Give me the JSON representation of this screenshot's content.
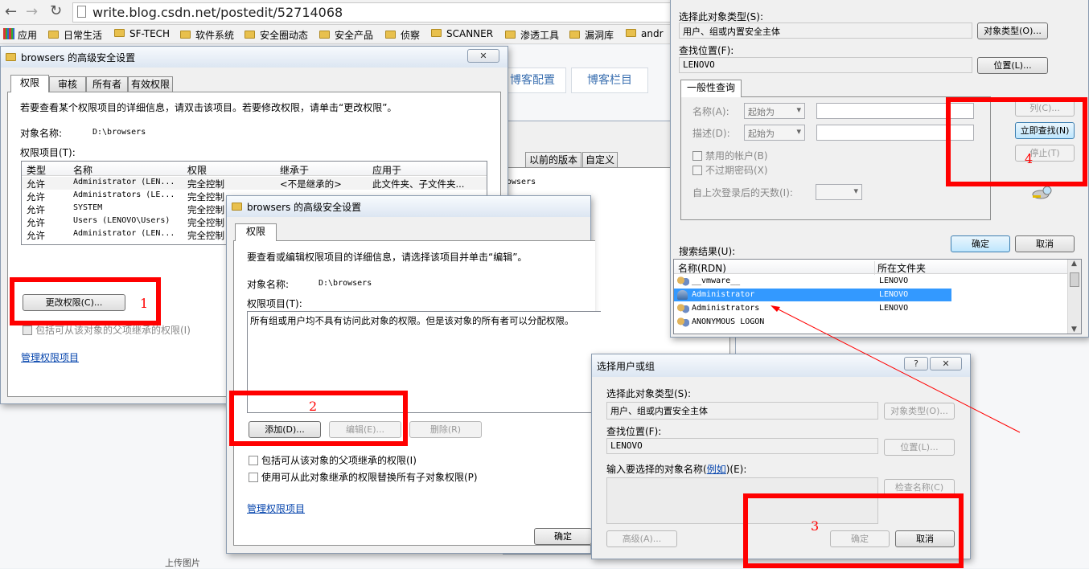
{
  "browser": {
    "url": "write.blog.csdn.net/postedit/52714068",
    "bookmarks": [
      "应用",
      "日常生活",
      "SF-TECH",
      "软件系统",
      "安全圈动态",
      "安全产品",
      "侦察",
      "SCANNER",
      "渗透工具",
      "漏洞库",
      "andr"
    ]
  },
  "bg": {
    "tabs": [
      "博客配置",
      "博客栏目"
    ],
    "tabs2": [
      "以前的版本",
      "自定义"
    ],
    "snip": "owsers",
    "bottom": "上传图片"
  },
  "dlg1": {
    "title": "browsers 的高级安全设置",
    "close": "✕",
    "tabs": [
      "权限",
      "审核",
      "所有者",
      "有效权限"
    ],
    "info": "若要查看某个权限项目的详细信息，请双击该项目。若要修改权限，请单击“更改权限”。",
    "obj_label": "对象名称:",
    "obj_value": "D:\\browsers",
    "perm_label": "权限项目(T):",
    "headers": [
      "类型",
      "名称",
      "权限",
      "继承于",
      "应用于"
    ],
    "rows": [
      [
        "允许",
        "Administrator (LEN...",
        "完全控制",
        "<不是继承的>",
        "此文件夹、子文件夹..."
      ],
      [
        "允许",
        "Administrators (LE...",
        "完全控制",
        "",
        ""
      ],
      [
        "允许",
        "SYSTEM",
        "完全控制",
        "",
        ""
      ],
      [
        "允许",
        "Users (LENOVO\\Users)",
        "完全控制",
        "",
        ""
      ],
      [
        "允许",
        "Administrator (LEN...",
        "完全控制",
        "",
        ""
      ]
    ],
    "change_btn": "更改权限(C)...",
    "include_chk": "包括可从该对象的父项继承的权限(I)",
    "manage_link": "管理权限项目"
  },
  "dlg2": {
    "title": "browsers 的高级安全设置",
    "tab": "权限",
    "info": "要查看或编辑权限项目的详细信息，请选择该项目并单击“编辑”。",
    "obj_label": "对象名称:",
    "obj_value": "D:\\browsers",
    "perm_label": "权限项目(T):",
    "empty_msg": "所有组或用户均不具有访问此对象的权限。但是该对象的所有者可以分配权限。",
    "add_btn": "添加(D)...",
    "edit_btn": "编辑(E)...",
    "del_btn": "删除(R)",
    "chk1": "包括可从该对象的父项继承的权限(I)",
    "chk2": "使用可从此对象继承的权限替换所有子对象权限(P)",
    "manage_link": "管理权限项目",
    "ok_btn": "确定"
  },
  "dlg3": {
    "title": "选择用户或组",
    "help": "?",
    "close": "✕",
    "type_label": "选择此对象类型(S):",
    "type_value": "用户、组或内置安全主体",
    "type_btn": "对象类型(O)...",
    "loc_label": "查找位置(F):",
    "loc_value": "LENOVO",
    "loc_btn": "位置(L)...",
    "name_label_a": "输入要选择的对象名称(",
    "name_link": "例如",
    "name_label_b": ")(E):",
    "check_btn": "检查名称(C)",
    "adv_btn": "高级(A)...",
    "ok_btn": "确定",
    "cancel_btn": "取消"
  },
  "dlg4": {
    "type_label": "选择此对象类型(S):",
    "type_value": "用户、组或内置安全主体",
    "type_btn": "对象类型(O)...",
    "loc_label": "查找位置(F):",
    "loc_value": "LENOVO",
    "loc_btn": "位置(L)...",
    "query_tab": "一般性查询",
    "name_label": "名称(A):",
    "desc_label": "描述(D):",
    "starts_with": "起始为",
    "disabled_chk": "禁用的帐户(B)",
    "noexpire_chk": "不过期密码(X)",
    "days_label": "自上次登录后的天数(I):",
    "cols_btn": "列(C)...",
    "find_btn": "立即查找(N)",
    "stop_btn": "停止(T)",
    "ok_btn": "确定",
    "cancel_btn": "取消",
    "results_label": "搜索结果(U):",
    "col_name": "名称(RDN)",
    "col_folder": "所在文件夹",
    "results": [
      {
        "name": "__vmware__",
        "folder": "LENOVO"
      },
      {
        "name": "Administrator",
        "folder": "LENOVO"
      },
      {
        "name": "Administrators",
        "folder": "LENOVO"
      },
      {
        "name": "ANONYMOUS LOGON",
        "folder": ""
      }
    ]
  },
  "annotations": [
    "1",
    "2",
    "3",
    "4"
  ],
  "colors": {
    "annotation": "#ff0000",
    "selection": "#3399ff",
    "link": "#0645ad"
  }
}
